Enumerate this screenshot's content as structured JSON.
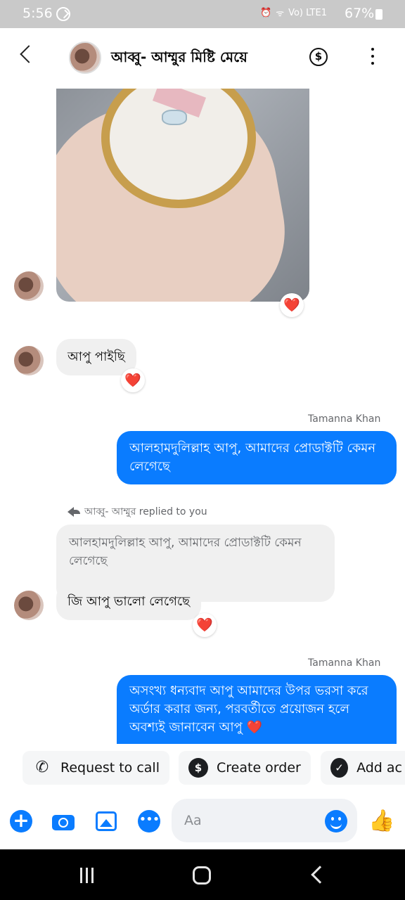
{
  "status_bar": {
    "time": "5:56",
    "signal_text": "Vo) LTE1",
    "battery": "67%"
  },
  "header": {
    "title": "আব্বু- আম্মুর মিষ্টি মেয়ে"
  },
  "messages": {
    "first_text": "আপু পাইছি",
    "reaction": "❤️",
    "outgoing_1": {
      "sender": "Tamanna Khan",
      "text": "আলহামদুলিল্লাহ আপু, আমাদের প্রোডাক্টটি কেমন লেগেছে"
    },
    "reply": {
      "note": "আব্বু- আম্মুর replied to you",
      "quoted": "আলহামদুলিল্লাহ আপু, আমাদের প্রোডাক্টটি কেমন লেগেছে",
      "text": "জি আপু ভালো লেগেছে"
    },
    "outgoing_2": {
      "sender": "Tamanna Khan",
      "text": "অসংখ্য ধন্যবাদ আপু আমাদের উপর ভরসা করে অর্ডার করার জন্য, পরবর্তীতে প্রয়োজন হলে অবশ্যই জানাবেন আপু ❤️"
    }
  },
  "actions": {
    "request_call": "Request to call",
    "create_order": "Create order",
    "add": "Add ac"
  },
  "composer": {
    "placeholder": "Aa"
  },
  "colors": {
    "accent": "#0a7cff",
    "bubble_in": "#f0f0f0",
    "reaction_heart": "#e41e3f"
  }
}
